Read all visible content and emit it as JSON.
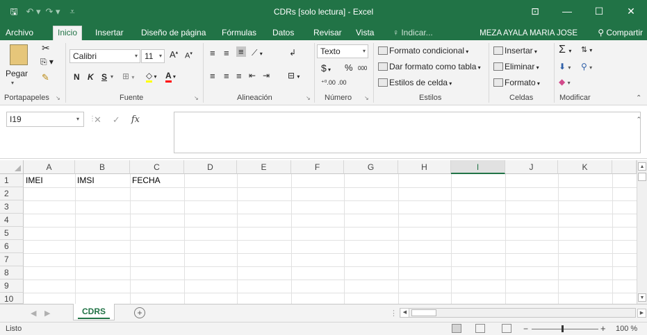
{
  "window": {
    "title": "CDRs  [solo lectura] - Excel",
    "qat": {
      "save": "🖫",
      "undo": "↶ ▾",
      "redo": "↷ ▾",
      "customize": "⩡"
    },
    "controls": {
      "ribbon_display": "⊡",
      "minimize": "—",
      "maximize": "☐",
      "close": "✕"
    }
  },
  "tabs": [
    "Archivo",
    "Inicio",
    "Insertar",
    "Diseño de página",
    "Fórmulas",
    "Datos",
    "Revisar",
    "Vista"
  ],
  "active_tab": "Inicio",
  "tell_me": "Indicar...",
  "user": "MEZA AYALA MARIA JOSE",
  "share": "Compartir",
  "ribbon": {
    "portapapeles": {
      "label": "Portapapeles",
      "paste": "Pegar"
    },
    "fuente": {
      "label": "Fuente",
      "font_name": "Calibri",
      "font_size": "11",
      "grow": "A",
      "shrink": "A",
      "bold": "N",
      "italic": "K",
      "underline": "S"
    },
    "alineacion": {
      "label": "Alineación"
    },
    "numero": {
      "label": "Número",
      "format": "Texto",
      "currency": "$",
      "percent": "%",
      "thousands": "000",
      "inc_dec": "⁺⁰.00",
      "dec_dec": ".00"
    },
    "estilos": {
      "label": "Estilos",
      "conditional": "Formato condicional",
      "as_table": "Dar formato como tabla",
      "cell_styles": "Estilos de celda"
    },
    "celdas": {
      "label": "Celdas",
      "insert": "Insertar",
      "delete": "Eliminar",
      "format": "Formato"
    },
    "modificar": {
      "label": "Modificar"
    }
  },
  "formula_bar": {
    "name_box": "I19",
    "formula": "",
    "fx": "fx"
  },
  "sheet": {
    "columns": [
      "A",
      "B",
      "C",
      "D",
      "E",
      "F",
      "G",
      "H",
      "I",
      "J",
      "K"
    ],
    "selected_column": "I",
    "rows": [
      "1",
      "2",
      "3",
      "4",
      "5",
      "6",
      "7",
      "8",
      "9",
      "10"
    ],
    "cells": {
      "A1": "IMEI",
      "B1": "IMSI",
      "C1": "FECHA"
    }
  },
  "sheet_tabs": [
    "CDRS"
  ],
  "active_sheet": "CDRS",
  "status": {
    "ready": "Listo",
    "zoom": "100 %"
  }
}
